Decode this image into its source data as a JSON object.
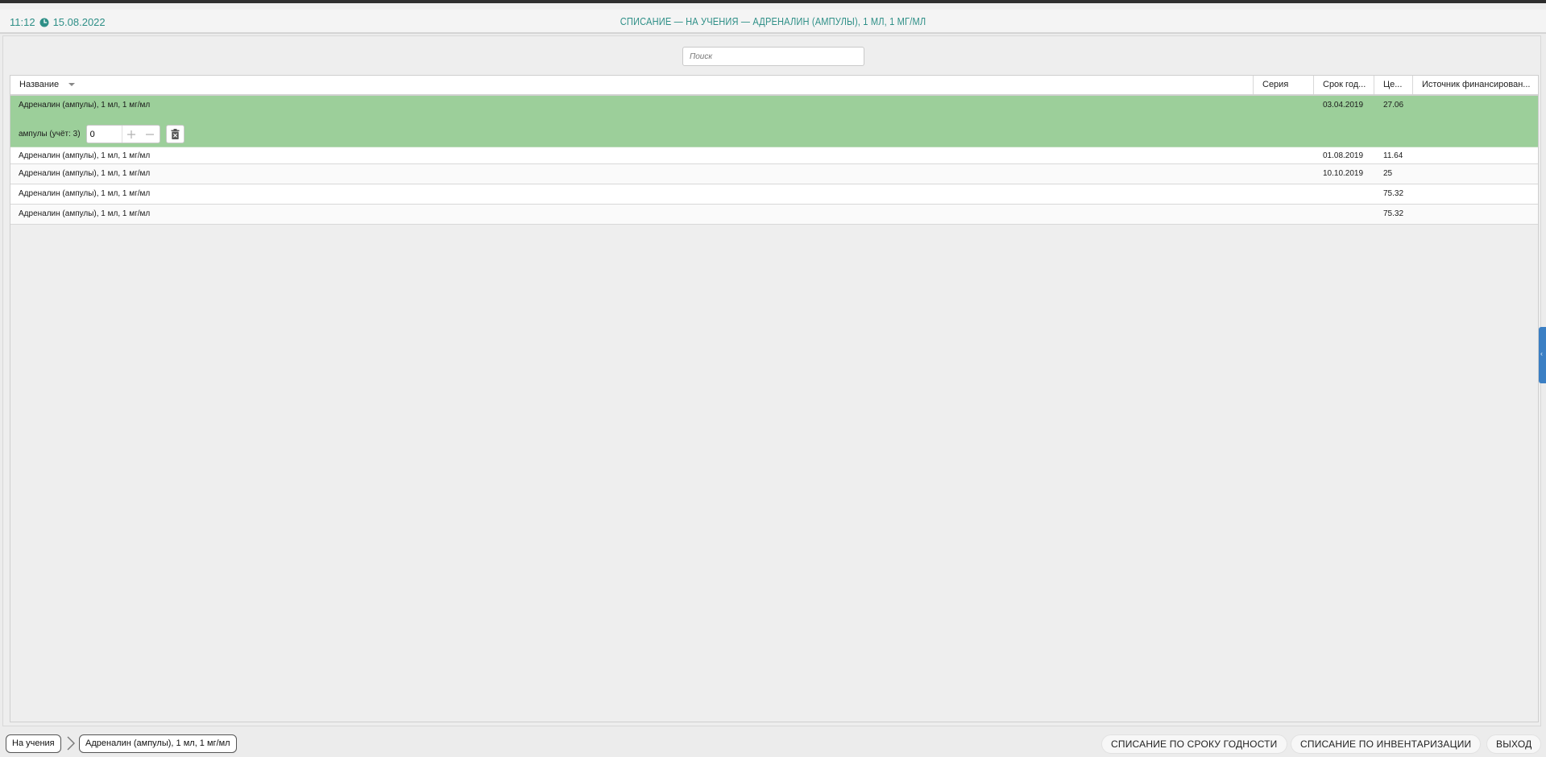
{
  "header": {
    "time": "11:12",
    "date": "15.08.2022",
    "title": "СПИСАНИЕ — НА УЧЕНИЯ — АДРЕНАЛИН (АМПУЛЫ), 1 МЛ, 1 МГ/МЛ"
  },
  "search": {
    "placeholder": "Поиск"
  },
  "table": {
    "columns": [
      {
        "label": "Название"
      },
      {
        "label": "Серия"
      },
      {
        "label": "Срок год..."
      },
      {
        "label": "Це..."
      },
      {
        "label": "Источник финансирован..."
      }
    ],
    "rows": [
      {
        "name": "Адреналин (ампулы), 1 мл, 1 мг/мл",
        "series": "",
        "expiry": "03.04.2019",
        "price": "27.06",
        "source": ""
      },
      {
        "name": "Адреналин (ампулы), 1 мл, 1 мг/мл",
        "series": "",
        "expiry": "01.08.2019",
        "price": "11.64",
        "source": ""
      },
      {
        "name": "Адреналин (ампулы), 1 мл, 1 мг/мл",
        "series": "",
        "expiry": "10.10.2019",
        "price": "25",
        "source": ""
      },
      {
        "name": "Адреналин (ампулы), 1 мл, 1 мг/мл",
        "series": "",
        "expiry": "",
        "price": "75.32",
        "source": ""
      },
      {
        "name": "Адреналин (ампулы), 1 мл, 1 мг/мл",
        "series": "",
        "expiry": "",
        "price": "75.32",
        "source": ""
      }
    ],
    "selected_detail": {
      "label": "ампулы (учёт: 3)",
      "quantity": "0"
    }
  },
  "breadcrumbs": [
    {
      "label": "На учения"
    },
    {
      "label": "Адреналин (ампулы), 1 мл, 1 мг/мл"
    }
  ],
  "footer": {
    "btn_expiry": "СПИСАНИЕ ПО СРОКУ ГОДНОСТИ",
    "btn_inventory": "СПИСАНИЕ ПО ИНВЕНТАРИЗАЦИИ",
    "btn_exit": "ВЫХОД"
  },
  "colors": {
    "accent": "#2e8f87",
    "selected_row": "#9ccf9a",
    "side_handle": "#3b7fc4"
  },
  "icons": {
    "clock": "clock-icon",
    "sort": "sort-down-icon",
    "plus": "plus-icon",
    "minus": "minus-icon",
    "trash": "trash-icon",
    "breadcrumb_sep": "chevron-right-icon",
    "side_panel": "collapse-left-icon"
  }
}
